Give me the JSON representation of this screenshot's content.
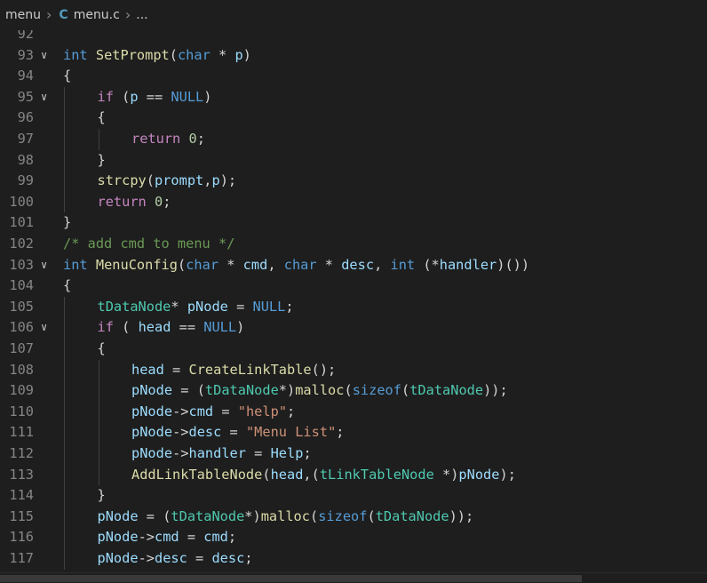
{
  "breadcrumb": {
    "folder": "menu",
    "file_icon": "C",
    "file": "menu.c",
    "rest": "..."
  },
  "lines": [
    {
      "n": "92",
      "fold": "",
      "indent": 0,
      "tokens": []
    },
    {
      "n": "93",
      "fold": "v",
      "indent": 0,
      "tokens": [
        [
          "kw",
          "int"
        ],
        [
          "pl",
          " "
        ],
        [
          "fn",
          "SetPrompt"
        ],
        [
          "pl",
          "("
        ],
        [
          "kw",
          "char"
        ],
        [
          "pl",
          " * "
        ],
        [
          "var",
          "p"
        ],
        [
          "pl",
          ")"
        ]
      ]
    },
    {
      "n": "94",
      "fold": "",
      "indent": 0,
      "tokens": [
        [
          "pl",
          "{"
        ]
      ]
    },
    {
      "n": "95",
      "fold": "v",
      "indent": 1,
      "tokens": [
        [
          "ctl",
          "if"
        ],
        [
          "pl",
          " ("
        ],
        [
          "var",
          "p"
        ],
        [
          "pl",
          " == "
        ],
        [
          "kw",
          "NULL"
        ],
        [
          "pl",
          ")"
        ]
      ]
    },
    {
      "n": "96",
      "fold": "",
      "indent": 1,
      "tokens": [
        [
          "pl",
          "{"
        ]
      ]
    },
    {
      "n": "97",
      "fold": "",
      "indent": 2,
      "tokens": [
        [
          "ctl",
          "return"
        ],
        [
          "pl",
          " "
        ],
        [
          "num",
          "0"
        ],
        [
          "pl",
          ";"
        ]
      ]
    },
    {
      "n": "98",
      "fold": "",
      "indent": 1,
      "tokens": [
        [
          "pl",
          "}"
        ]
      ]
    },
    {
      "n": "99",
      "fold": "",
      "indent": 1,
      "tokens": [
        [
          "fn",
          "strcpy"
        ],
        [
          "pl",
          "("
        ],
        [
          "var",
          "prompt"
        ],
        [
          "pl",
          ","
        ],
        [
          "var",
          "p"
        ],
        [
          "pl",
          ");"
        ]
      ]
    },
    {
      "n": "100",
      "fold": "",
      "indent": 1,
      "tokens": [
        [
          "ctl",
          "return"
        ],
        [
          "pl",
          " "
        ],
        [
          "num",
          "0"
        ],
        [
          "pl",
          ";"
        ]
      ]
    },
    {
      "n": "101",
      "fold": "",
      "indent": 0,
      "tokens": [
        [
          "pl",
          "}"
        ]
      ]
    },
    {
      "n": "102",
      "fold": "",
      "indent": 0,
      "tokens": [
        [
          "cm",
          "/* add cmd to menu */"
        ]
      ]
    },
    {
      "n": "103",
      "fold": "v",
      "indent": 0,
      "tokens": [
        [
          "kw",
          "int"
        ],
        [
          "pl",
          " "
        ],
        [
          "fn",
          "MenuConfig"
        ],
        [
          "pl",
          "("
        ],
        [
          "kw",
          "char"
        ],
        [
          "pl",
          " * "
        ],
        [
          "var",
          "cmd"
        ],
        [
          "pl",
          ", "
        ],
        [
          "kw",
          "char"
        ],
        [
          "pl",
          " * "
        ],
        [
          "var",
          "desc"
        ],
        [
          "pl",
          ", "
        ],
        [
          "kw",
          "int"
        ],
        [
          "pl",
          " (*"
        ],
        [
          "var",
          "handler"
        ],
        [
          "pl",
          ")())"
        ]
      ]
    },
    {
      "n": "104",
      "fold": "",
      "indent": 0,
      "tokens": [
        [
          "pl",
          "{"
        ]
      ]
    },
    {
      "n": "105",
      "fold": "",
      "indent": 1,
      "tokens": [
        [
          "ty",
          "tDataNode"
        ],
        [
          "pl",
          "* "
        ],
        [
          "var",
          "pNode"
        ],
        [
          "pl",
          " = "
        ],
        [
          "kw",
          "NULL"
        ],
        [
          "pl",
          ";"
        ]
      ]
    },
    {
      "n": "106",
      "fold": "v",
      "indent": 1,
      "tokens": [
        [
          "ctl",
          "if"
        ],
        [
          "pl",
          " ( "
        ],
        [
          "var",
          "head"
        ],
        [
          "pl",
          " == "
        ],
        [
          "kw",
          "NULL"
        ],
        [
          "pl",
          ")"
        ]
      ]
    },
    {
      "n": "107",
      "fold": "",
      "indent": 1,
      "tokens": [
        [
          "pl",
          "{"
        ]
      ]
    },
    {
      "n": "108",
      "fold": "",
      "indent": 2,
      "tokens": [
        [
          "var",
          "head"
        ],
        [
          "pl",
          " = "
        ],
        [
          "fn",
          "CreateLinkTable"
        ],
        [
          "pl",
          "();"
        ]
      ]
    },
    {
      "n": "109",
      "fold": "",
      "indent": 2,
      "tokens": [
        [
          "var",
          "pNode"
        ],
        [
          "pl",
          " = ("
        ],
        [
          "ty",
          "tDataNode"
        ],
        [
          "pl",
          "*)"
        ],
        [
          "fn",
          "malloc"
        ],
        [
          "pl",
          "("
        ],
        [
          "kw",
          "sizeof"
        ],
        [
          "pl",
          "("
        ],
        [
          "ty",
          "tDataNode"
        ],
        [
          "pl",
          "));"
        ]
      ]
    },
    {
      "n": "110",
      "fold": "",
      "indent": 2,
      "tokens": [
        [
          "var",
          "pNode"
        ],
        [
          "pl",
          "->"
        ],
        [
          "var",
          "cmd"
        ],
        [
          "pl",
          " = "
        ],
        [
          "str",
          "\"help\""
        ],
        [
          "pl",
          ";"
        ]
      ]
    },
    {
      "n": "111",
      "fold": "",
      "indent": 2,
      "tokens": [
        [
          "var",
          "pNode"
        ],
        [
          "pl",
          "->"
        ],
        [
          "var",
          "desc"
        ],
        [
          "pl",
          " = "
        ],
        [
          "str",
          "\"Menu List\""
        ],
        [
          "pl",
          ";"
        ]
      ]
    },
    {
      "n": "112",
      "fold": "",
      "indent": 2,
      "tokens": [
        [
          "var",
          "pNode"
        ],
        [
          "pl",
          "->"
        ],
        [
          "var",
          "handler"
        ],
        [
          "pl",
          " = "
        ],
        [
          "var",
          "Help"
        ],
        [
          "pl",
          ";"
        ]
      ]
    },
    {
      "n": "113",
      "fold": "",
      "indent": 2,
      "tokens": [
        [
          "fn",
          "AddLinkTableNode"
        ],
        [
          "pl",
          "("
        ],
        [
          "var",
          "head"
        ],
        [
          "pl",
          ",("
        ],
        [
          "ty",
          "tLinkTableNode"
        ],
        [
          "pl",
          " *)"
        ],
        [
          "var",
          "pNode"
        ],
        [
          "pl",
          ");"
        ]
      ]
    },
    {
      "n": "114",
      "fold": "",
      "indent": 1,
      "tokens": [
        [
          "pl",
          "}"
        ]
      ]
    },
    {
      "n": "115",
      "fold": "",
      "indent": 1,
      "tokens": [
        [
          "var",
          "pNode"
        ],
        [
          "pl",
          " = ("
        ],
        [
          "ty",
          "tDataNode"
        ],
        [
          "pl",
          "*)"
        ],
        [
          "fn",
          "malloc"
        ],
        [
          "pl",
          "("
        ],
        [
          "kw",
          "sizeof"
        ],
        [
          "pl",
          "("
        ],
        [
          "ty",
          "tDataNode"
        ],
        [
          "pl",
          "));"
        ]
      ]
    },
    {
      "n": "116",
      "fold": "",
      "indent": 1,
      "tokens": [
        [
          "var",
          "pNode"
        ],
        [
          "pl",
          "->"
        ],
        [
          "var",
          "cmd"
        ],
        [
          "pl",
          " = "
        ],
        [
          "var",
          "cmd"
        ],
        [
          "pl",
          ";"
        ]
      ]
    },
    {
      "n": "117",
      "fold": "",
      "indent": 1,
      "tokens": [
        [
          "var",
          "pNode"
        ],
        [
          "pl",
          "->"
        ],
        [
          "var",
          "desc"
        ],
        [
          "pl",
          " = "
        ],
        [
          "var",
          "desc"
        ],
        [
          "pl",
          ";"
        ]
      ]
    }
  ]
}
